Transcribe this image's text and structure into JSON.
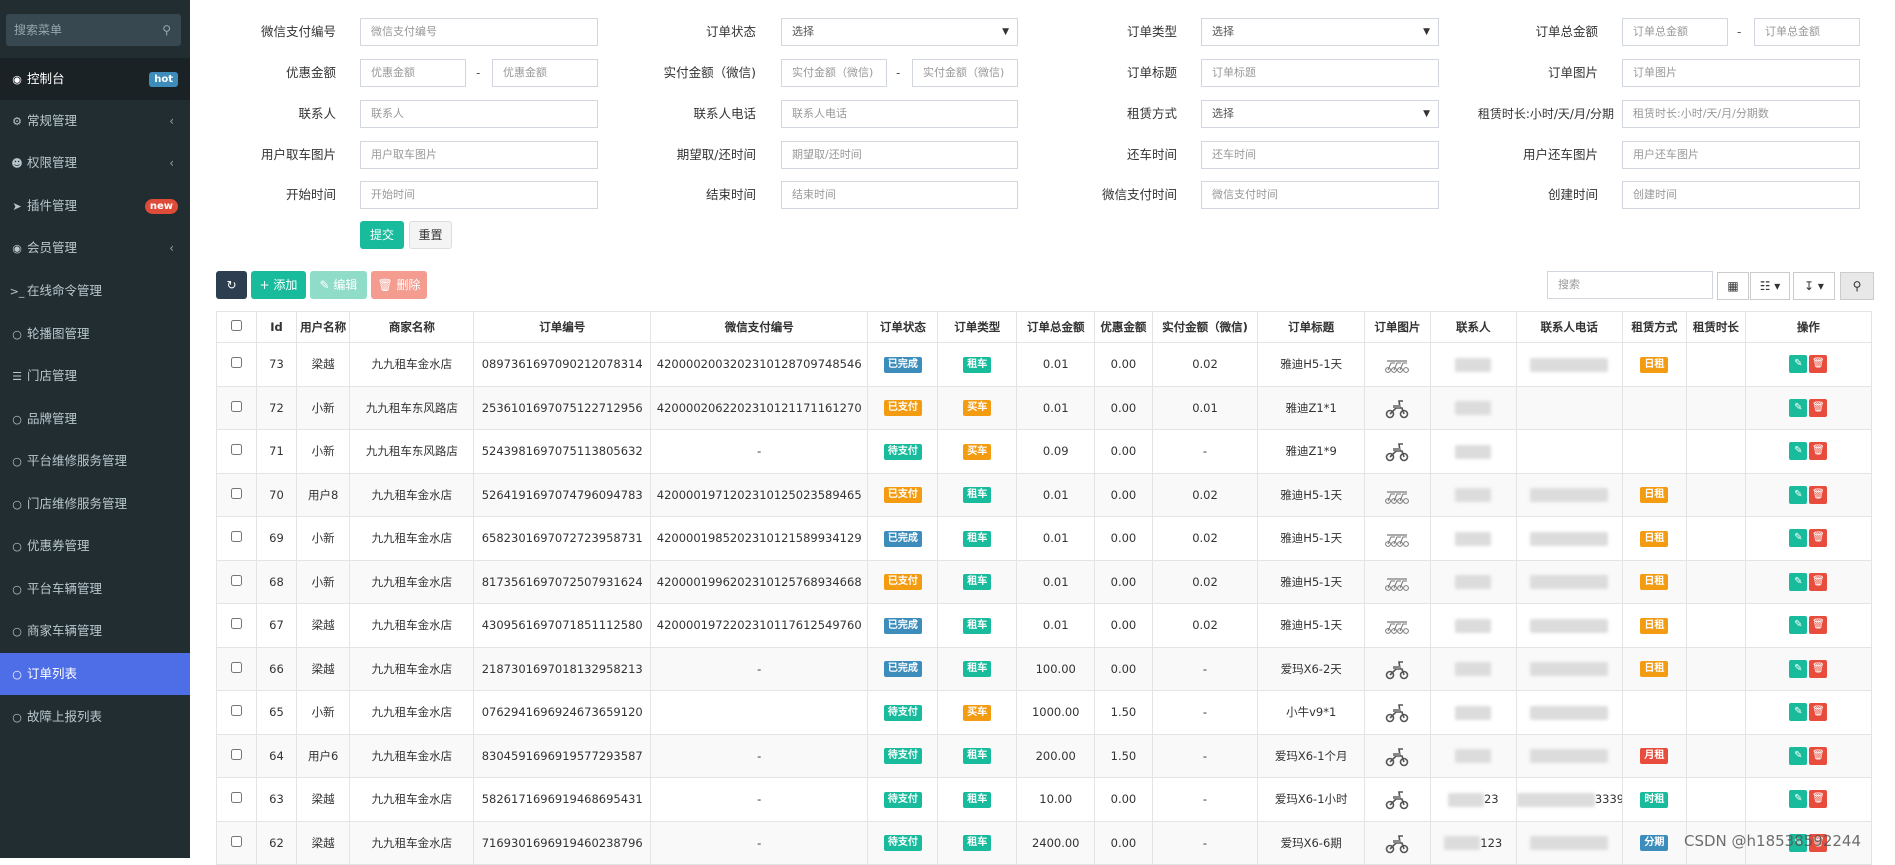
{
  "sidebar": {
    "search_placeholder": "搜索菜单",
    "items": [
      {
        "label": "控制台",
        "icon": "dashboard-icon",
        "badge": "hot"
      },
      {
        "label": "常规管理",
        "icon": "cogs-icon",
        "arrow": "‹"
      },
      {
        "label": "权限管理",
        "icon": "group-icon",
        "arrow": "‹"
      },
      {
        "label": "插件管理",
        "icon": "rocket-icon",
        "badge": "new"
      },
      {
        "label": "会员管理",
        "icon": "user-circle-icon",
        "arrow": "‹"
      },
      {
        "label": "在线命令管理",
        "icon": "terminal-icon"
      },
      {
        "label": "轮播图管理",
        "icon": "circle-icon"
      },
      {
        "label": "门店管理",
        "icon": "list-icon"
      },
      {
        "label": "品牌管理",
        "icon": "circle-icon"
      },
      {
        "label": "平台维修服务管理",
        "icon": "circle-icon"
      },
      {
        "label": "门店维修服务管理",
        "icon": "circle-icon"
      },
      {
        "label": "优惠券管理",
        "icon": "circle-icon"
      },
      {
        "label": "平台车辆管理",
        "icon": "circle-icon"
      },
      {
        "label": "商家车辆管理",
        "icon": "circle-icon"
      },
      {
        "label": "订单列表",
        "icon": "circle-icon"
      },
      {
        "label": "故障上报列表",
        "icon": "circle-icon"
      }
    ]
  },
  "filters": {
    "row1": {
      "wx_label": "微信支付编号",
      "wx_ph": "微信支付编号",
      "status_label": "订单状态",
      "status_value": "选择",
      "type_label": "订单类型",
      "type_value": "选择",
      "total_label": "订单总金额",
      "total_ph": "订单总金额"
    },
    "row2": {
      "disc_label": "优惠金额",
      "disc_ph": "优惠金额",
      "paid_label": "实付金额（微信)",
      "paid_ph": "实付金额（微信)",
      "title_label": "订单标题",
      "title_ph": "订单标题",
      "img_label": "订单图片",
      "img_ph": "订单图片"
    },
    "row3": {
      "contact_label": "联系人",
      "contact_ph": "联系人",
      "phone_label": "联系人电话",
      "phone_ph": "联系人电话",
      "rent_label": "租赁方式",
      "rent_value": "选择",
      "dur_label": "租赁时长:小时/天/月/分期",
      "dur_ph": "租赁时长:小时/天/月/分期数"
    },
    "row4": {
      "pick_img_label": "用户取车图片",
      "pick_img_ph": "用户取车图片",
      "expect_label": "期望取/还时间",
      "expect_ph": "期望取/还时间",
      "return_label": "还车时间",
      "return_ph": "还车时间",
      "ret_img_label": "用户还车图片",
      "ret_img_ph": "用户还车图片"
    },
    "row5": {
      "start_label": "开始时间",
      "start_ph": "开始时间",
      "end_label": "结束时间",
      "end_ph": "结束时间",
      "wxtime_label": "微信支付时间",
      "wxtime_ph": "微信支付时间",
      "create_label": "创建时间",
      "create_ph": "创建时间"
    },
    "submit": "提交",
    "reset": "重置",
    "dash": "-"
  },
  "toolbar": {
    "add": "添加",
    "edit": "编辑",
    "delete": "删除",
    "search_placeholder": "搜索"
  },
  "table": {
    "headers": [
      "Id",
      "用户名称",
      "商家名称",
      "订单编号",
      "微信支付编号",
      "订单状态",
      "订单类型",
      "订单总金额",
      "优惠金额",
      "实付金额（微信)",
      "订单标题",
      "订单图片",
      "联系人",
      "联系人电话",
      "租赁方式",
      "租赁时长",
      "操作"
    ],
    "rows": [
      {
        "id": "73",
        "user": "梁越",
        "shop": "九九租车金水店",
        "order_no": "0897361697090212078314",
        "wx_no": "4200002003202310128709748546",
        "status": "已完成",
        "type": "租车",
        "total": "0.01",
        "disc": "0.00",
        "paid": "0.02",
        "title": "雅迪H5-1天",
        "contact": "",
        "phone": "",
        "rent": "日租"
      },
      {
        "id": "72",
        "user": "小新",
        "shop": "九九租车东风路店",
        "order_no": "2536101697075122712956",
        "wx_no": "4200002062202310121171161270",
        "status": "已支付",
        "type": "买车",
        "total": "0.01",
        "disc": "0.00",
        "paid": "0.01",
        "title": "雅迪Z1*1",
        "contact": "",
        "phone": "",
        "rent": ""
      },
      {
        "id": "71",
        "user": "小新",
        "shop": "九九租车东风路店",
        "order_no": "5243981697075113805632",
        "wx_no": "-",
        "status": "待支付",
        "type": "买车",
        "total": "0.09",
        "disc": "0.00",
        "paid": "-",
        "title": "雅迪Z1*9",
        "contact": "",
        "phone": "",
        "rent": ""
      },
      {
        "id": "70",
        "user": "用户8",
        "shop": "九九租车金水店",
        "order_no": "5264191697074796094783",
        "wx_no": "4200001971202310125023589465",
        "status": "已支付",
        "type": "租车",
        "total": "0.01",
        "disc": "0.00",
        "paid": "0.02",
        "title": "雅迪H5-1天",
        "contact": "",
        "phone": "",
        "rent": "日租"
      },
      {
        "id": "69",
        "user": "小新",
        "shop": "九九租车金水店",
        "order_no": "6582301697072723958731",
        "wx_no": "4200001985202310121589934129",
        "status": "已完成",
        "type": "租车",
        "total": "0.01",
        "disc": "0.00",
        "paid": "0.02",
        "title": "雅迪H5-1天",
        "contact": "",
        "phone": "",
        "rent": "日租"
      },
      {
        "id": "68",
        "user": "小新",
        "shop": "九九租车金水店",
        "order_no": "8173561697072507931624",
        "wx_no": "4200001996202310125768934668",
        "status": "已支付",
        "type": "租车",
        "total": "0.01",
        "disc": "0.00",
        "paid": "0.02",
        "title": "雅迪H5-1天",
        "contact": "",
        "phone": "",
        "rent": "日租"
      },
      {
        "id": "67",
        "user": "梁越",
        "shop": "九九租车金水店",
        "order_no": "4309561697071851112580",
        "wx_no": "4200001972202310117612549760",
        "status": "已完成",
        "type": "租车",
        "total": "0.01",
        "disc": "0.00",
        "paid": "0.02",
        "title": "雅迪H5-1天",
        "contact": "",
        "phone": "",
        "rent": "日租"
      },
      {
        "id": "66",
        "user": "梁越",
        "shop": "九九租车金水店",
        "order_no": "2187301697018132958213",
        "wx_no": "-",
        "status": "已完成",
        "type": "租车",
        "total": "100.00",
        "disc": "0.00",
        "paid": "-",
        "title": "爱玛X6-2天",
        "contact": "",
        "phone": "",
        "rent": "日租"
      },
      {
        "id": "65",
        "user": "小新",
        "shop": "九九租车金水店",
        "order_no": "0762941696924673659120",
        "wx_no": "",
        "status": "待支付",
        "type": "买车",
        "total": "1000.00",
        "disc": "1.50",
        "paid": "-",
        "title": "小牛v9*1",
        "contact": "",
        "phone": "",
        "rent": ""
      },
      {
        "id": "64",
        "user": "用户6",
        "shop": "九九租车金水店",
        "order_no": "8304591696919577293587",
        "wx_no": "-",
        "status": "待支付",
        "type": "租车",
        "total": "200.00",
        "disc": "1.50",
        "paid": "-",
        "title": "爱玛X6-1个月",
        "contact": "",
        "phone": "",
        "rent": "月租"
      },
      {
        "id": "63",
        "user": "梁越",
        "shop": "九九租车金水店",
        "order_no": "5826171696919468695431",
        "wx_no": "-",
        "status": "待支付",
        "type": "租车",
        "total": "10.00",
        "disc": "0.00",
        "paid": "-",
        "title": "爱玛X6-1小时",
        "contact": "23",
        "phone": "33391",
        "rent": "时租"
      },
      {
        "id": "62",
        "user": "梁越",
        "shop": "九九租车金水店",
        "order_no": "7169301696919460238796",
        "wx_no": "-",
        "status": "待支付",
        "type": "租车",
        "total": "2400.00",
        "disc": "0.00",
        "paid": "-",
        "title": "爱玛X6-6期",
        "contact": "123",
        "phone": "",
        "rent": "分期"
      }
    ]
  },
  "colors": {
    "已完成": "#3c8dbc",
    "已支付": "#f39c12",
    "待支付": "#18bc9c",
    "租车": "#18bc9c",
    "买车": "#f39c12",
    "日租": "#f39c12",
    "月租": "#e74c3c",
    "时租": "#18bc9c",
    "分期": "#3c8dbc"
  },
  "watermark": "CSDN @h18538592244"
}
